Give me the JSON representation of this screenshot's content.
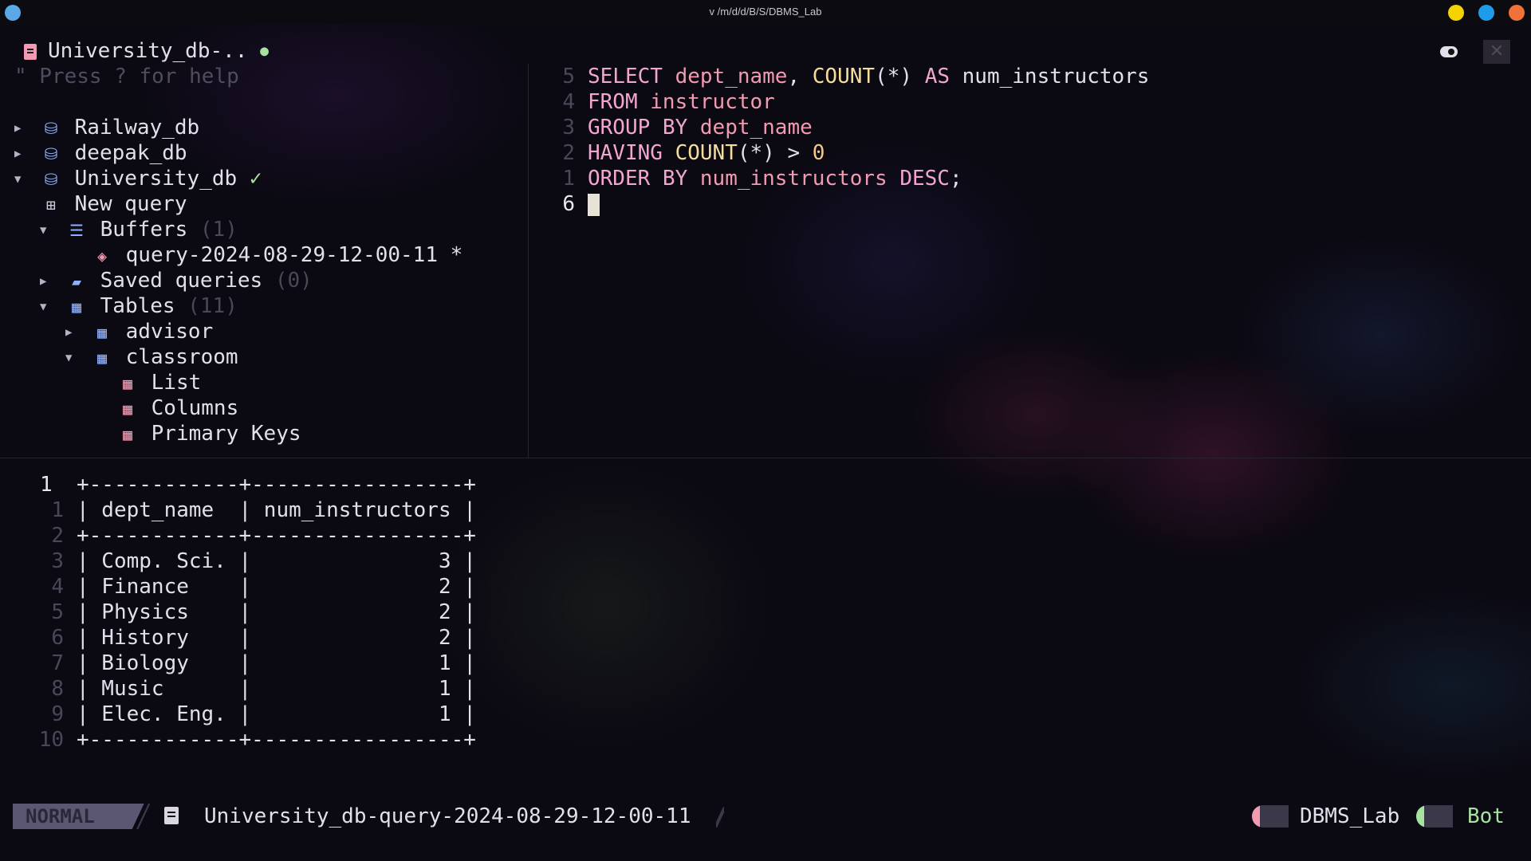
{
  "window": {
    "title": "v /m/d/d/B/S/DBMS_Lab",
    "dot_colors": {
      "left": "#5aa8e8",
      "yellow": "#f5d300",
      "blue": "#1e9be9",
      "orange": "#f0723a"
    }
  },
  "drawer": {
    "tab_title": "University_db-..",
    "help_text": "\" Press ? for help",
    "items": [
      {
        "label": "Railway_db",
        "arrow": "▶",
        "icon": "database-icon"
      },
      {
        "label": "deepak_db",
        "arrow": "▶",
        "icon": "database-icon"
      },
      {
        "label": "University_db",
        "arrow": "▼",
        "icon": "database-icon",
        "status": "✓"
      },
      {
        "label": "New query",
        "icon": "new-query-icon"
      },
      {
        "label": "Buffers",
        "arrow": "▼",
        "icon": "list-icon",
        "count": "(1)"
      },
      {
        "label": "query-2024-08-29-12-00-11 *",
        "icon": "buffer-stack-icon"
      },
      {
        "label": "Saved queries",
        "arrow": "▶",
        "icon": "folder-icon",
        "count": "(0)"
      },
      {
        "label": "Tables",
        "arrow": "▼",
        "icon": "table-icon",
        "count": "(11)"
      },
      {
        "label": "advisor",
        "arrow": "▶",
        "icon": "table-icon"
      },
      {
        "label": "classroom",
        "arrow": "▼",
        "icon": "table-icon"
      },
      {
        "label": "List",
        "icon": "table-helper-icon"
      },
      {
        "label": "Columns",
        "icon": "table-helper-icon"
      },
      {
        "label": "Primary Keys",
        "icon": "table-helper-icon"
      }
    ]
  },
  "editor": {
    "lines": [
      {
        "num": "5",
        "tokens": [
          [
            "kw",
            "SELECT "
          ],
          [
            "id",
            "dept_name"
          ],
          [
            "op",
            ", "
          ],
          [
            "fn",
            "COUNT"
          ],
          [
            "op",
            "(*) "
          ],
          [
            "kw",
            "AS "
          ],
          [
            "op",
            "num_instructors"
          ]
        ]
      },
      {
        "num": "4",
        "tokens": [
          [
            "kw",
            "FROM "
          ],
          [
            "id",
            "instructor"
          ]
        ]
      },
      {
        "num": "3",
        "tokens": [
          [
            "kw",
            "GROUP BY "
          ],
          [
            "id",
            "dept_name"
          ]
        ]
      },
      {
        "num": "2",
        "tokens": [
          [
            "kw",
            "HAVING "
          ],
          [
            "fn",
            "COUNT"
          ],
          [
            "op",
            "(*) > "
          ],
          [
            "num",
            "0"
          ]
        ]
      },
      {
        "num": "1",
        "tokens": [
          [
            "kw",
            "ORDER BY "
          ],
          [
            "id",
            "num_instructors "
          ],
          [
            "kw",
            "DESC"
          ],
          [
            "op",
            ";"
          ]
        ]
      },
      {
        "num": "6",
        "tokens": [],
        "current": true
      }
    ]
  },
  "results": {
    "lines": [
      {
        "num": "1",
        "text": "+------------+-----------------+",
        "current": true
      },
      {
        "num": "1",
        "text": "| dept_name  | num_instructors |"
      },
      {
        "num": "2",
        "text": "+------------+-----------------+"
      },
      {
        "num": "3",
        "text": "| Comp. Sci. |               3 |"
      },
      {
        "num": "4",
        "text": "| Finance    |               2 |"
      },
      {
        "num": "5",
        "text": "| Physics    |               2 |"
      },
      {
        "num": "6",
        "text": "| History    |               2 |"
      },
      {
        "num": "7",
        "text": "| Biology    |               1 |"
      },
      {
        "num": "8",
        "text": "| Music      |               1 |"
      },
      {
        "num": "9",
        "text": "| Elec. Eng. |               1 |"
      },
      {
        "num": "10",
        "text": "+------------+-----------------+"
      }
    ]
  },
  "statusline": {
    "mode": "NORMAL",
    "filename": "University_db-query-2024-08-29-12-00-11",
    "cwd": "DBMS_Lab",
    "position": "Bot"
  }
}
